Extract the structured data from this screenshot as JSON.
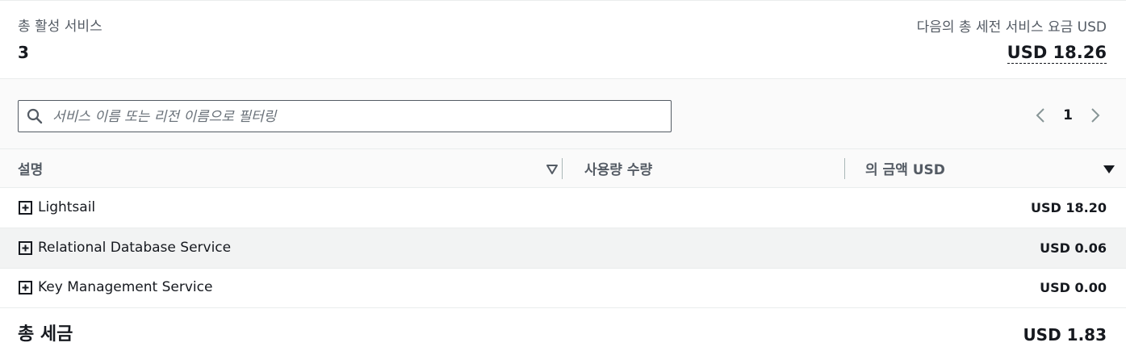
{
  "summary": {
    "active_services_label": "총 활성 서비스",
    "active_services_count": "3",
    "estimated_charges_label": "다음의 총 세전 서비스 요금 USD",
    "estimated_charges_value": "USD 18.26"
  },
  "filter": {
    "placeholder": "서비스 이름 또는 리전 이름으로 필터링",
    "value": ""
  },
  "pagination": {
    "current_page": "1"
  },
  "table": {
    "columns": {
      "description": "설명",
      "usage_quantity": "사용량 수량",
      "amount": "의 금액 USD"
    },
    "rows": [
      {
        "name": "Lightsail",
        "amount": "USD 18.20"
      },
      {
        "name": "Relational Database Service",
        "amount": "USD 0.06"
      },
      {
        "name": "Key Management Service",
        "amount": "USD 0.00"
      }
    ],
    "total_tax_label": "총 세금",
    "total_tax_value": "USD 1.83"
  },
  "icons": {
    "search": "search-icon",
    "prev": "chevron-left-icon",
    "next": "chevron-right-icon",
    "expand": "plus-square-icon",
    "sort_open": "sort-caret-outline-icon",
    "sort_filled": "sort-caret-filled-icon"
  },
  "colors": {
    "text_primary": "#16191f",
    "text_secondary": "#545b64",
    "border": "#eaeded",
    "row_alt_bg": "#f2f3f3",
    "icon_muted": "#879596"
  }
}
